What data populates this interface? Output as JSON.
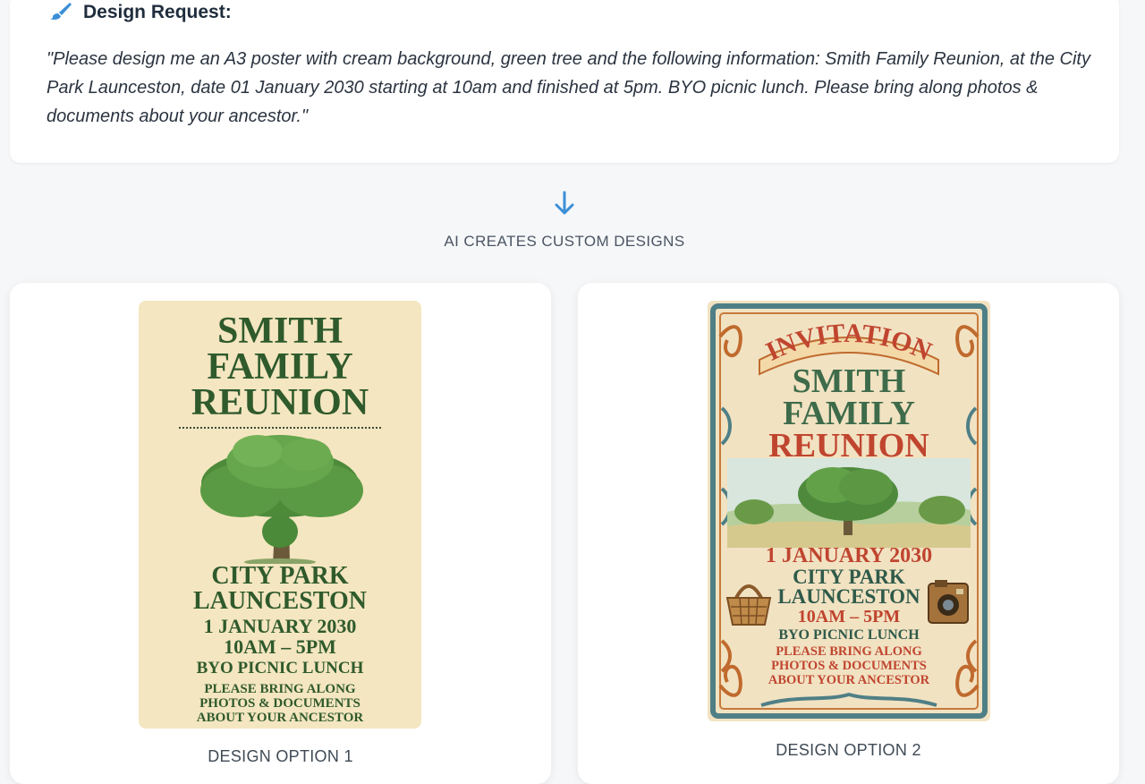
{
  "request": {
    "title": "Design Request:",
    "text": "\"Please design me an A3 poster with cream background, green tree and the following information: Smith Family Reunion, at the City Park Launceston, date 01 January 2030 starting at 10am and finished at 5pm. BYO picnic lunch. Please bring along photos & documents about your ancestor.\""
  },
  "flow": {
    "label": "AI CREATES CUSTOM DESIGNS"
  },
  "designs": [
    {
      "label": "DESIGN OPTION 1",
      "poster": {
        "title": [
          "SMITH",
          "FAMILY",
          "REUNION"
        ],
        "location": [
          "CITY PARK",
          "LAUNCESTON"
        ],
        "date": "1 JANUARY 2030",
        "time": "10AM – 5PM",
        "lunch": "BYO PICNIC LUNCH",
        "bring": [
          "PLEASE BRING ALONG",
          "PHOTOS & DOCUMENTS",
          "ABOUT YOUR ANCESTOR"
        ]
      }
    },
    {
      "label": "DESIGN OPTION 2",
      "poster": {
        "banner": "INVITATION",
        "title": [
          "SMITH",
          "FAMILY",
          "REUNION"
        ],
        "date": "1 JANUARY 2030",
        "location": [
          "CITY PARK",
          "LAUNCESTON"
        ],
        "time": "10AM – 5PM",
        "lunch": "BYO PICNIC LUNCH",
        "bring": [
          "PLEASE BRING ALONG",
          "PHOTOS & DOCUMENTS",
          "ABOUT YOUR ANCESTOR"
        ]
      }
    }
  ],
  "colors": {
    "accent": "#3b8fd6",
    "poster_green": "#2f5a2c",
    "poster_red": "#c0452f",
    "cream": "#f4e6c0"
  },
  "icons": {
    "request": "paintbrush-icon",
    "flow": "arrow-down-icon"
  }
}
